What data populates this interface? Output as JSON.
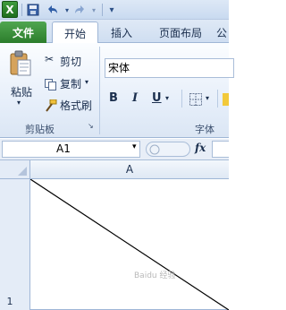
{
  "quick_access": {
    "app_icon_letter": "X",
    "save_icon": "save-icon",
    "undo_icon": "undo-icon",
    "redo_icon": "redo-icon",
    "customize_icon": "customize-qat-icon"
  },
  "tabs": [
    {
      "label": "文件"
    },
    {
      "label": "开始"
    },
    {
      "label": "插入"
    },
    {
      "label": "页面布局"
    },
    {
      "label": "公"
    }
  ],
  "clipboard_group": {
    "paste_label": "粘贴",
    "cut_label": "剪切",
    "copy_label": "复制",
    "format_painter_label": "格式刷",
    "group_label": "剪贴板"
  },
  "font_group": {
    "font_name": "宋体",
    "bold_label": "B",
    "italic_label": "I",
    "underline_label": "U",
    "group_label": "字体"
  },
  "formula_bar": {
    "name_box_value": "A1",
    "fx_label": "fx"
  },
  "grid": {
    "column_header": "A",
    "row_header": "1"
  },
  "watermark": "Baidu 经验",
  "colors": {
    "file_tab": "#2c7d2c",
    "ribbon_bg": "#e4edf9",
    "header_bg": "#e4ecf7"
  }
}
